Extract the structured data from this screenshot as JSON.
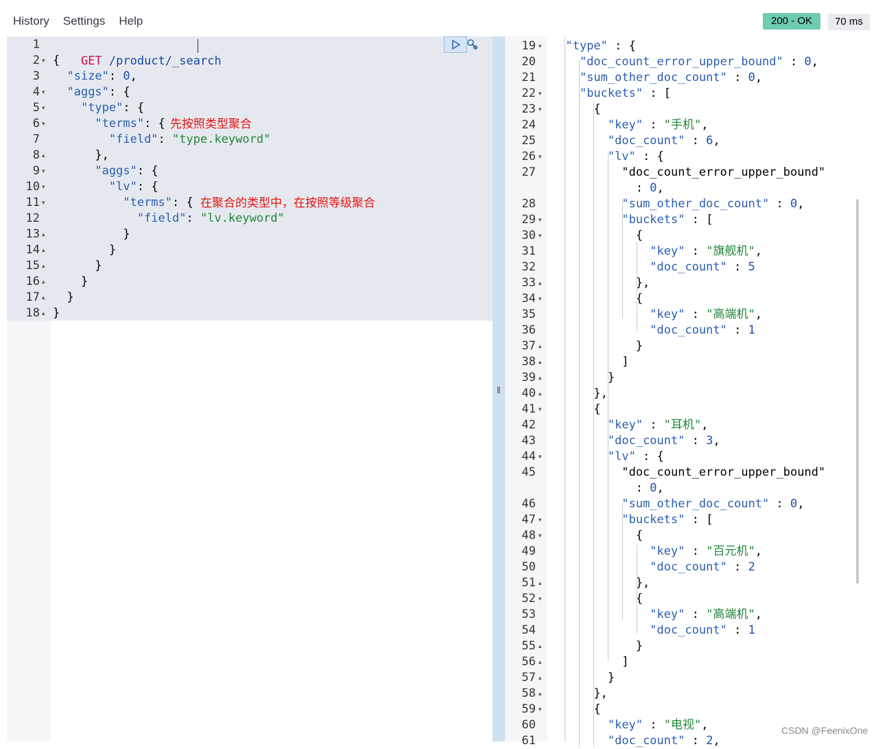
{
  "menu": {
    "history": "History",
    "settings": "Settings",
    "help": "Help"
  },
  "status": {
    "code": "200 - OK",
    "timing": "70 ms"
  },
  "request": {
    "method": "GET",
    "path": "/product/_search",
    "lines": [
      {
        "n": "1",
        "t": ""
      },
      {
        "n": "2",
        "t": "{"
      },
      {
        "n": "3",
        "t": "  \"size\": 0,"
      },
      {
        "n": "4",
        "t": "  \"aggs\": {"
      },
      {
        "n": "5",
        "t": "    \"type\": {"
      },
      {
        "n": "6",
        "t": "      \"terms\": {"
      },
      {
        "n": "7",
        "t": "        \"field\": \"type.keyword\""
      },
      {
        "n": "8",
        "t": "      },"
      },
      {
        "n": "9",
        "t": "      \"aggs\": {"
      },
      {
        "n": "10",
        "t": "        \"lv\": {"
      },
      {
        "n": "11",
        "t": "          \"terms\": {"
      },
      {
        "n": "12",
        "t": "            \"field\": \"lv.keyword\""
      },
      {
        "n": "13",
        "t": "          }"
      },
      {
        "n": "14",
        "t": "        }"
      },
      {
        "n": "15",
        "t": "      }"
      },
      {
        "n": "16",
        "t": "    }"
      },
      {
        "n": "17",
        "t": "  }"
      },
      {
        "n": "18",
        "t": "}"
      }
    ],
    "annotation_1": "先按照类型聚合",
    "annotation_2": "在聚合的类型中，在按照等级聚合"
  },
  "response": {
    "lines": [
      {
        "n": "19",
        "t": "  \"type\" : {"
      },
      {
        "n": "20",
        "t": "    \"doc_count_error_upper_bound\" : 0,"
      },
      {
        "n": "21",
        "t": "    \"sum_other_doc_count\" : 0,"
      },
      {
        "n": "22",
        "t": "    \"buckets\" : ["
      },
      {
        "n": "23",
        "t": "      {"
      },
      {
        "n": "24",
        "t": "        \"key\" : \"手机\","
      },
      {
        "n": "25",
        "t": "        \"doc_count\" : 6,"
      },
      {
        "n": "26",
        "t": "        \"lv\" : {"
      },
      {
        "n": "27",
        "t": "          \"doc_count_error_upper_bound\""
      },
      {
        "n": "",
        "t": "            : 0,"
      },
      {
        "n": "28",
        "t": "          \"sum_other_doc_count\" : 0,"
      },
      {
        "n": "29",
        "t": "          \"buckets\" : ["
      },
      {
        "n": "30",
        "t": "            {"
      },
      {
        "n": "31",
        "t": "              \"key\" : \"旗舰机\","
      },
      {
        "n": "32",
        "t": "              \"doc_count\" : 5"
      },
      {
        "n": "33",
        "t": "            },"
      },
      {
        "n": "34",
        "t": "            {"
      },
      {
        "n": "35",
        "t": "              \"key\" : \"高端机\","
      },
      {
        "n": "36",
        "t": "              \"doc_count\" : 1"
      },
      {
        "n": "37",
        "t": "            }"
      },
      {
        "n": "38",
        "t": "          ]"
      },
      {
        "n": "39",
        "t": "        }"
      },
      {
        "n": "40",
        "t": "      },"
      },
      {
        "n": "41",
        "t": "      {"
      },
      {
        "n": "42",
        "t": "        \"key\" : \"耳机\","
      },
      {
        "n": "43",
        "t": "        \"doc_count\" : 3,"
      },
      {
        "n": "44",
        "t": "        \"lv\" : {"
      },
      {
        "n": "45",
        "t": "          \"doc_count_error_upper_bound\""
      },
      {
        "n": "",
        "t": "            : 0,"
      },
      {
        "n": "46",
        "t": "          \"sum_other_doc_count\" : 0,"
      },
      {
        "n": "47",
        "t": "          \"buckets\" : ["
      },
      {
        "n": "48",
        "t": "            {"
      },
      {
        "n": "49",
        "t": "              \"key\" : \"百元机\","
      },
      {
        "n": "50",
        "t": "              \"doc_count\" : 2"
      },
      {
        "n": "51",
        "t": "            },"
      },
      {
        "n": "52",
        "t": "            {"
      },
      {
        "n": "53",
        "t": "              \"key\" : \"高端机\","
      },
      {
        "n": "54",
        "t": "              \"doc_count\" : 1"
      },
      {
        "n": "55",
        "t": "            }"
      },
      {
        "n": "56",
        "t": "          ]"
      },
      {
        "n": "57",
        "t": "        }"
      },
      {
        "n": "58",
        "t": "      },"
      },
      {
        "n": "59",
        "t": "      {"
      },
      {
        "n": "60",
        "t": "        \"key\" : \"电视\","
      },
      {
        "n": "61",
        "t": "        \"doc_count\" : 2,"
      }
    ]
  },
  "watermark": "CSDN @FeenixOne"
}
